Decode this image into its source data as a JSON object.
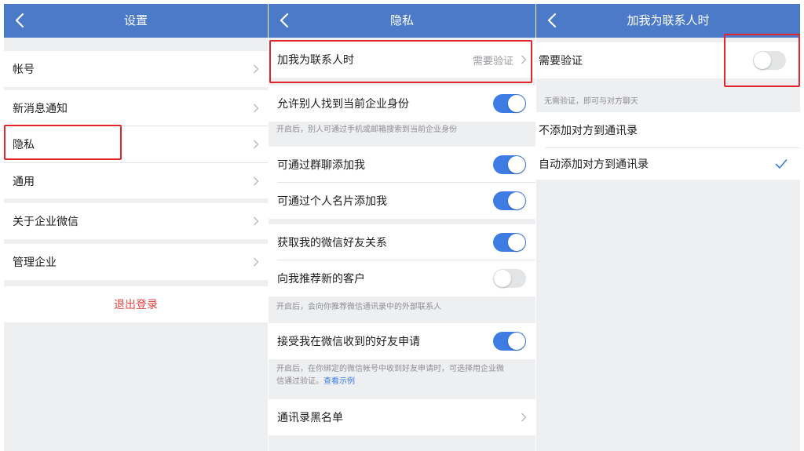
{
  "colors": {
    "navbar": "#4a7ac8",
    "accent": "#3e7ce3",
    "danger": "#e64340",
    "highlight": "#e0262b"
  },
  "settings_screen": {
    "title": "设置",
    "back_icon": "chevron-left-icon",
    "items": [
      {
        "label": "帐号"
      },
      {
        "label": "新消息通知"
      },
      {
        "label": "隐私"
      },
      {
        "label": "通用"
      },
      {
        "label": "关于企业微信"
      },
      {
        "label": "管理企业"
      }
    ],
    "logout_label": "退出登录"
  },
  "privacy_screen": {
    "title": "隐私",
    "add_me_row": {
      "label": "加我为联系人时",
      "value": "需要验证"
    },
    "find_identity": {
      "label": "允许别人找到当前企业身份",
      "enabled": true
    },
    "find_identity_note": "开启后，别人可通过手机或邮箱搜索到当前企业身份",
    "add_via_group": {
      "label": "可通过群聊添加我",
      "enabled": true
    },
    "add_via_card": {
      "label": "可通过个人名片添加我",
      "enabled": true
    },
    "wechat_friends": {
      "label": "获取我的微信好友关系",
      "enabled": true
    },
    "recommend_customers": {
      "label": "向我推荐新的客户",
      "enabled": false
    },
    "recommend_note": "开启后，会向你推荐微信通讯录中的外部联系人",
    "accept_requests": {
      "label": "接受我在微信收到的好友申请",
      "enabled": true
    },
    "accept_note_line1": "开启后，在你绑定的微信帐号中收到好友申请时，可选择用企业微",
    "accept_note_line2": "信通过验证。",
    "accept_note_link": "查看示例",
    "blacklist_label": "通讯录黑名单"
  },
  "add_contact_screen": {
    "title": "加我为联系人时",
    "require_verification": {
      "label": "需要验证",
      "enabled": false
    },
    "section_header": "无需验证，即可与对方聊天",
    "options": [
      {
        "label": "不添加对方到通讯录",
        "selected": false
      },
      {
        "label": "自动添加对方到通讯录",
        "selected": true
      }
    ]
  }
}
